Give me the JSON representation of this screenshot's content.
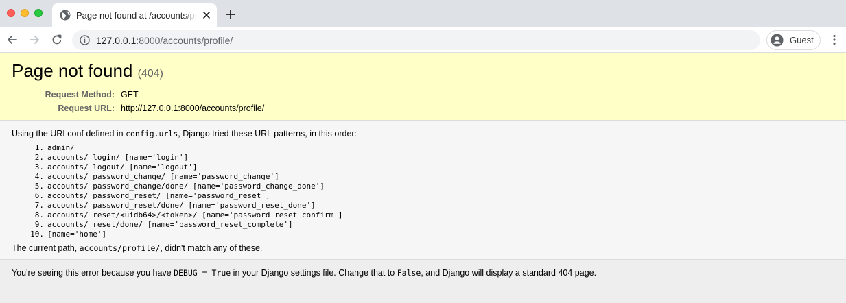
{
  "browser": {
    "tab": {
      "title": "Page not found at /accounts/profile/"
    },
    "address": {
      "host": "127.0.0.1",
      "rest": ":8000/accounts/profile/"
    },
    "profile": {
      "label": "Guest"
    }
  },
  "error": {
    "title": "Page not found",
    "code": "(404)",
    "request": [
      {
        "label": "Request Method:",
        "value": "GET"
      },
      {
        "label": "Request URL:",
        "value": "http://127.0.0.1:8000/accounts/profile/"
      }
    ],
    "urlconf": {
      "prefix": "Using the URLconf defined in ",
      "module": "config.urls",
      "suffix": ", Django tried these URL patterns, in this order:"
    },
    "patterns": [
      {
        "num": "1.",
        "text": "admin/"
      },
      {
        "num": "2.",
        "text": "accounts/ login/ [name='login']"
      },
      {
        "num": "3.",
        "text": "accounts/ logout/ [name='logout']"
      },
      {
        "num": "4.",
        "text": "accounts/ password_change/ [name='password_change']"
      },
      {
        "num": "5.",
        "text": "accounts/ password_change/done/ [name='password_change_done']"
      },
      {
        "num": "6.",
        "text": "accounts/ password_reset/ [name='password_reset']"
      },
      {
        "num": "7.",
        "text": "accounts/ password_reset/done/ [name='password_reset_done']"
      },
      {
        "num": "8.",
        "text": "accounts/ reset/<uidb64>/<token>/ [name='password_reset_confirm']"
      },
      {
        "num": "9.",
        "text": "accounts/ reset/done/ [name='password_reset_complete']"
      },
      {
        "num": "10.",
        "text": "[name='home']"
      }
    ],
    "current_path": {
      "prefix": "The current path, ",
      "path": "accounts/profile/",
      "suffix": ", didn't match any of these."
    },
    "explanation": {
      "p1": "You're seeing this error because you have ",
      "debug": "DEBUG = True",
      "p2": " in your Django settings file. Change that to ",
      "false": "False",
      "p3": ", and Django will display a standard 404 page."
    }
  },
  "colors": {
    "summary_bg": "#ffffc8",
    "info_bg": "#f6f6f6",
    "explanation_bg": "#eeeeee",
    "tabstrip_bg": "#dee1e6"
  }
}
